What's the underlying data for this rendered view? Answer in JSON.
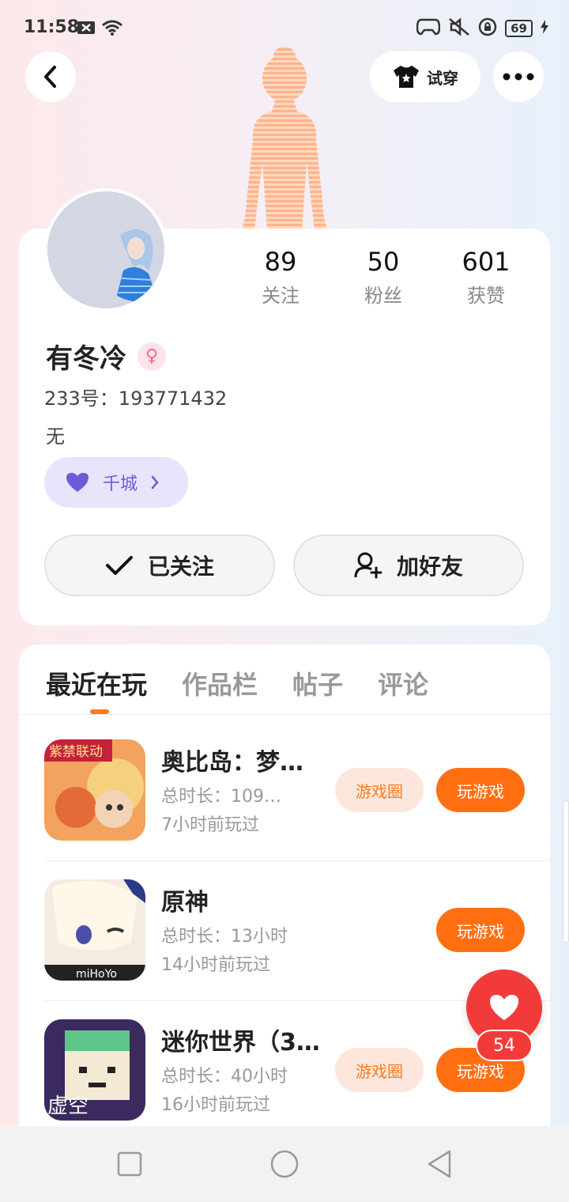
{
  "status_bar": {
    "time": "11:58",
    "battery": "69"
  },
  "header": {
    "tryon_label": "试穿"
  },
  "profile": {
    "stats": [
      {
        "value": "89",
        "label": "关注"
      },
      {
        "value": "50",
        "label": "粉丝"
      },
      {
        "value": "601",
        "label": "获赞"
      }
    ],
    "username": "有冬冷",
    "gender_symbol": "♀",
    "user_id": "233号：193771432",
    "bio": "无",
    "tag": "千城",
    "followed_label": "已关注",
    "add_friend_label": "加好友"
  },
  "tabs": [
    "最近在玩",
    "作品栏",
    "帖子",
    "评论"
  ],
  "games": [
    {
      "name": "奥比岛：梦…",
      "duration": "总时长：109…",
      "last_played": "7小时前玩过",
      "circle_label": "游戏圈",
      "play_label": "玩游戏",
      "icon_badge": "紫禁联动"
    },
    {
      "name": "原神",
      "duration": "总时长：13小时",
      "last_played": "14小时前玩过",
      "play_label": "玩游戏",
      "icon_badge": "miHoYo"
    },
    {
      "name": "迷你世界（3…",
      "duration": "总时长：40小时",
      "last_played": "16小时前玩过",
      "circle_label": "游戏圈",
      "play_label": "玩游戏",
      "icon_badge": "虚空"
    }
  ],
  "like": {
    "count": "54"
  },
  "colors": {
    "accent": "#ff6f12",
    "like": "#f23a3a",
    "tag_text": "#6a5cd9"
  }
}
